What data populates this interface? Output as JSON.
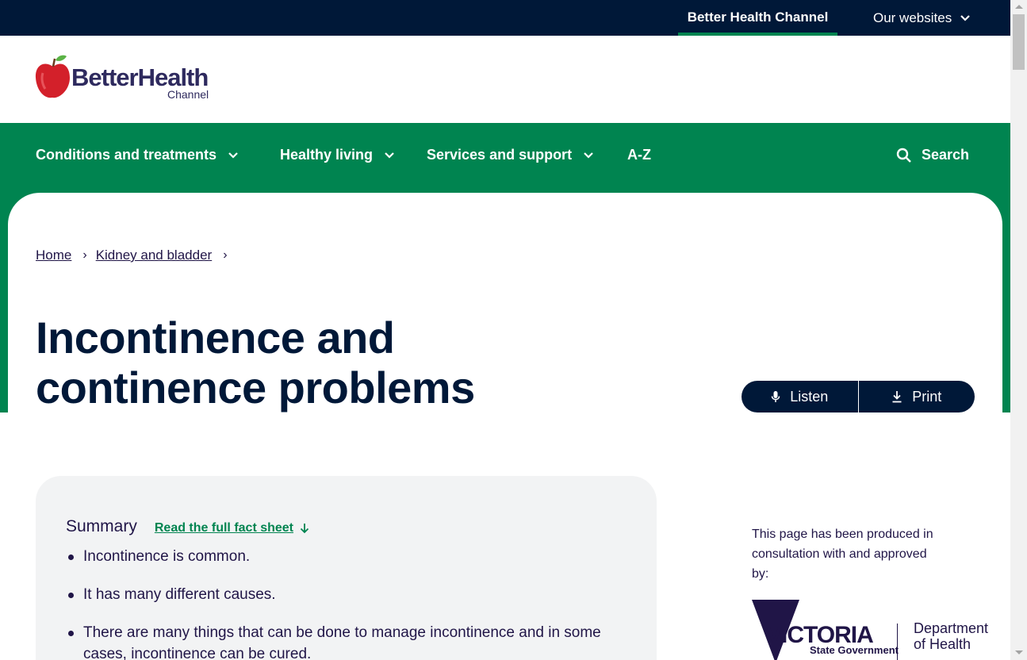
{
  "topbar": {
    "current_site": "Better Health Channel",
    "our_websites": "Our websites"
  },
  "logo": {
    "wordmark": "BetterHealth",
    "sub": "Channel"
  },
  "nav": {
    "items": [
      {
        "label": "Conditions and treatments"
      },
      {
        "label": "Healthy living"
      },
      {
        "label": "Services and support"
      },
      {
        "label": "A-Z"
      }
    ],
    "search_label": "Search"
  },
  "breadcrumb": {
    "home": "Home",
    "section": "Kidney and bladder"
  },
  "page": {
    "title_line1": "Incontinence and",
    "title_line2": "continence problems"
  },
  "actions": {
    "listen": "Listen",
    "print": "Print"
  },
  "summary": {
    "title": "Summary",
    "read_full": "Read the full fact sheet",
    "points": [
      "Incontinence is common.",
      "It has many different causes.",
      "There are many things that can be done to manage incontinence and in some cases, incontinence can be cured."
    ]
  },
  "approval": {
    "text": "This page has been produced in consultation with and approved by:",
    "logo_text": "VICTORIA",
    "logo_sub": "State Government",
    "dept_line1": "Department",
    "dept_line2": "of Health"
  },
  "colors": {
    "navy": "#001838",
    "green": "#008450",
    "summary_bg": "#f2f3f4"
  }
}
